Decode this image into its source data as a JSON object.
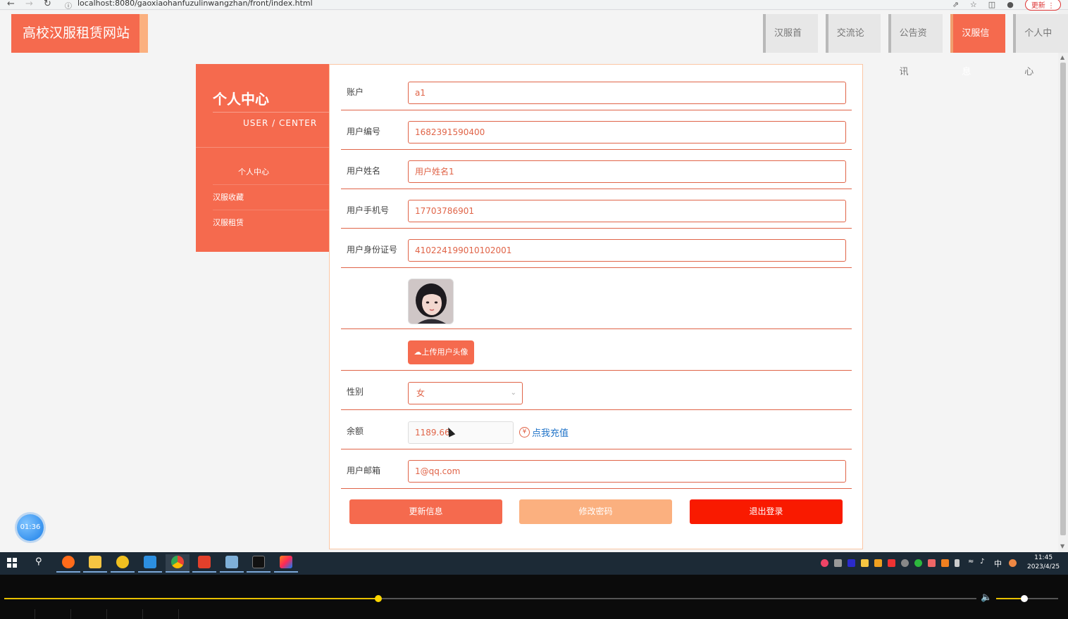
{
  "browser": {
    "url": "localhost:8080/gaoxiaohanfuzulinwangzhan/front/index.html",
    "update_label": "更新"
  },
  "site": {
    "logo_text": "高校汉服租赁网站"
  },
  "topnav": [
    {
      "label": "汉服首页",
      "active": false
    },
    {
      "label": "交流论坛",
      "active": false
    },
    {
      "label": "公告资讯",
      "active": false
    },
    {
      "label": "汉服信息",
      "active": true
    },
    {
      "label": "个人中心",
      "active": false
    }
  ],
  "sidebar": {
    "title": "个人中心",
    "subtitle": "USER / CENTER",
    "items": [
      {
        "label": "个人中心"
      },
      {
        "label": "汉服收藏"
      },
      {
        "label": "汉服租赁"
      }
    ]
  },
  "form": {
    "account_label": "账户",
    "account_value": "a1",
    "user_no_label": "用户编号",
    "user_no_value": "1682391590400",
    "user_name_label": "用户姓名",
    "user_name_value": "用户姓名1",
    "phone_label": "用户手机号",
    "phone_value": "17703786901",
    "idcard_label": "用户身份证号",
    "idcard_value": "410224199010102001",
    "upload_label": "上传用户头像",
    "gender_label": "性别",
    "gender_value": "女",
    "balance_label": "余额",
    "balance_value": "1189.66",
    "recharge_label": "点我充值",
    "email_label": "用户邮箱",
    "email_value": "1@qq.com"
  },
  "actions": {
    "update_label": "更新信息",
    "change_pwd_label": "修改密码",
    "logout_label": "退出登录"
  },
  "colors": {
    "primary": "#f56a4e",
    "accent": "#fbb07f",
    "logout": "#f91a00",
    "link": "#1f73c8"
  },
  "timer": "01:36",
  "taskbar": {
    "time": "11:45",
    "date": "2023/4/25",
    "ime": "中"
  },
  "player": {
    "progress": 0.385,
    "volume": 0.45
  }
}
